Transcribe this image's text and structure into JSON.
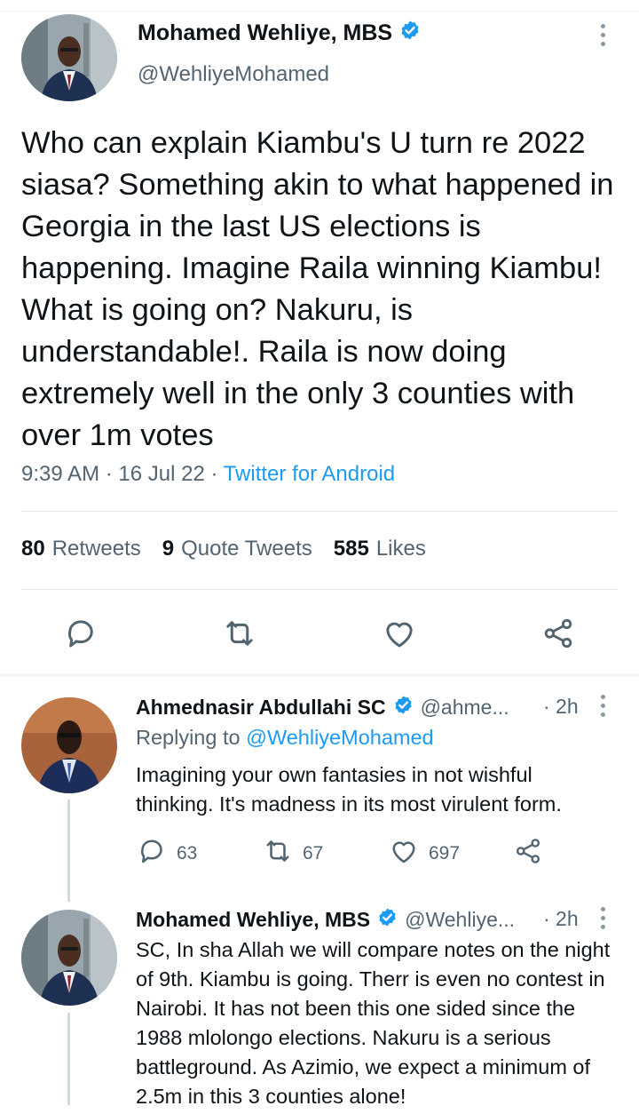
{
  "main_tweet": {
    "author_name": "Mohamed Wehliye, MBS",
    "handle": "@WehliyeMohamed",
    "text": "Who can explain Kiambu's U turn re 2022 siasa? Something akin to what happened in Georgia in the last US elections is happening. Imagine Raila winning Kiambu! What is going on? Nakuru, is understandable!. Raila is now doing extremely well in the only 3 counties with over 1m votes",
    "time": "9:39 AM",
    "date": "16 Jul 22",
    "source": "Twitter for Android",
    "stats": {
      "retweets_count": "80",
      "retweets_label": "Retweets",
      "quotes_count": "9",
      "quotes_label": "Quote Tweets",
      "likes_count": "585",
      "likes_label": "Likes"
    }
  },
  "replies": [
    {
      "author_name": "Ahmednasir Abdullahi SC",
      "handle": "@ahme...",
      "time": "· 2h",
      "replying_prefix": "Replying to",
      "replying_to": "@WehliyeMohamed",
      "text": "Imagining your own fantasies in not wishful thinking. It's madness in its most virulent form.",
      "replies_count": "63",
      "retweets_count": "67",
      "likes_count": "697"
    },
    {
      "author_name": "Mohamed Wehliye, MBS",
      "handle": "@Wehliye...",
      "time": "· 2h",
      "text": "SC, In sha Allah we will compare notes on the night of 9th. Kiambu is going. Therr is even no contest in Nairobi. It has not been this one sided since the 1988 mlolongo elections. Nakuru is a serious battleground. As Azimio, we expect a minimum of 2.5m in this 3 counties alone!"
    }
  ],
  "colors": {
    "accent": "#1d9bf0",
    "text_primary": "#0f1419",
    "text_secondary": "#536471",
    "divider": "#e3e8eb"
  },
  "icons": [
    "verified-badge-icon",
    "more-options-icon",
    "reply-icon",
    "retweet-icon",
    "like-icon",
    "share-icon"
  ]
}
